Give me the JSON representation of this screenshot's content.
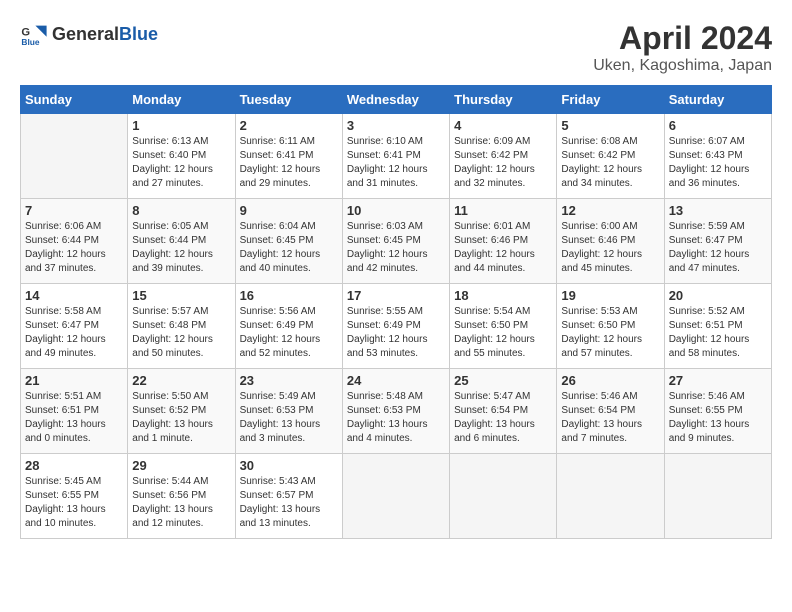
{
  "header": {
    "logo_general": "General",
    "logo_blue": "Blue",
    "title": "April 2024",
    "subtitle": "Uken, Kagoshima, Japan"
  },
  "days_of_week": [
    "Sunday",
    "Monday",
    "Tuesday",
    "Wednesday",
    "Thursday",
    "Friday",
    "Saturday"
  ],
  "weeks": [
    [
      {
        "day": "",
        "info": ""
      },
      {
        "day": "1",
        "info": "Sunrise: 6:13 AM\nSunset: 6:40 PM\nDaylight: 12 hours\nand 27 minutes."
      },
      {
        "day": "2",
        "info": "Sunrise: 6:11 AM\nSunset: 6:41 PM\nDaylight: 12 hours\nand 29 minutes."
      },
      {
        "day": "3",
        "info": "Sunrise: 6:10 AM\nSunset: 6:41 PM\nDaylight: 12 hours\nand 31 minutes."
      },
      {
        "day": "4",
        "info": "Sunrise: 6:09 AM\nSunset: 6:42 PM\nDaylight: 12 hours\nand 32 minutes."
      },
      {
        "day": "5",
        "info": "Sunrise: 6:08 AM\nSunset: 6:42 PM\nDaylight: 12 hours\nand 34 minutes."
      },
      {
        "day": "6",
        "info": "Sunrise: 6:07 AM\nSunset: 6:43 PM\nDaylight: 12 hours\nand 36 minutes."
      }
    ],
    [
      {
        "day": "7",
        "info": "Sunrise: 6:06 AM\nSunset: 6:44 PM\nDaylight: 12 hours\nand 37 minutes."
      },
      {
        "day": "8",
        "info": "Sunrise: 6:05 AM\nSunset: 6:44 PM\nDaylight: 12 hours\nand 39 minutes."
      },
      {
        "day": "9",
        "info": "Sunrise: 6:04 AM\nSunset: 6:45 PM\nDaylight: 12 hours\nand 40 minutes."
      },
      {
        "day": "10",
        "info": "Sunrise: 6:03 AM\nSunset: 6:45 PM\nDaylight: 12 hours\nand 42 minutes."
      },
      {
        "day": "11",
        "info": "Sunrise: 6:01 AM\nSunset: 6:46 PM\nDaylight: 12 hours\nand 44 minutes."
      },
      {
        "day": "12",
        "info": "Sunrise: 6:00 AM\nSunset: 6:46 PM\nDaylight: 12 hours\nand 45 minutes."
      },
      {
        "day": "13",
        "info": "Sunrise: 5:59 AM\nSunset: 6:47 PM\nDaylight: 12 hours\nand 47 minutes."
      }
    ],
    [
      {
        "day": "14",
        "info": "Sunrise: 5:58 AM\nSunset: 6:47 PM\nDaylight: 12 hours\nand 49 minutes."
      },
      {
        "day": "15",
        "info": "Sunrise: 5:57 AM\nSunset: 6:48 PM\nDaylight: 12 hours\nand 50 minutes."
      },
      {
        "day": "16",
        "info": "Sunrise: 5:56 AM\nSunset: 6:49 PM\nDaylight: 12 hours\nand 52 minutes."
      },
      {
        "day": "17",
        "info": "Sunrise: 5:55 AM\nSunset: 6:49 PM\nDaylight: 12 hours\nand 53 minutes."
      },
      {
        "day": "18",
        "info": "Sunrise: 5:54 AM\nSunset: 6:50 PM\nDaylight: 12 hours\nand 55 minutes."
      },
      {
        "day": "19",
        "info": "Sunrise: 5:53 AM\nSunset: 6:50 PM\nDaylight: 12 hours\nand 57 minutes."
      },
      {
        "day": "20",
        "info": "Sunrise: 5:52 AM\nSunset: 6:51 PM\nDaylight: 12 hours\nand 58 minutes."
      }
    ],
    [
      {
        "day": "21",
        "info": "Sunrise: 5:51 AM\nSunset: 6:51 PM\nDaylight: 13 hours\nand 0 minutes."
      },
      {
        "day": "22",
        "info": "Sunrise: 5:50 AM\nSunset: 6:52 PM\nDaylight: 13 hours\nand 1 minute."
      },
      {
        "day": "23",
        "info": "Sunrise: 5:49 AM\nSunset: 6:53 PM\nDaylight: 13 hours\nand 3 minutes."
      },
      {
        "day": "24",
        "info": "Sunrise: 5:48 AM\nSunset: 6:53 PM\nDaylight: 13 hours\nand 4 minutes."
      },
      {
        "day": "25",
        "info": "Sunrise: 5:47 AM\nSunset: 6:54 PM\nDaylight: 13 hours\nand 6 minutes."
      },
      {
        "day": "26",
        "info": "Sunrise: 5:46 AM\nSunset: 6:54 PM\nDaylight: 13 hours\nand 7 minutes."
      },
      {
        "day": "27",
        "info": "Sunrise: 5:46 AM\nSunset: 6:55 PM\nDaylight: 13 hours\nand 9 minutes."
      }
    ],
    [
      {
        "day": "28",
        "info": "Sunrise: 5:45 AM\nSunset: 6:55 PM\nDaylight: 13 hours\nand 10 minutes."
      },
      {
        "day": "29",
        "info": "Sunrise: 5:44 AM\nSunset: 6:56 PM\nDaylight: 13 hours\nand 12 minutes."
      },
      {
        "day": "30",
        "info": "Sunrise: 5:43 AM\nSunset: 6:57 PM\nDaylight: 13 hours\nand 13 minutes."
      },
      {
        "day": "",
        "info": ""
      },
      {
        "day": "",
        "info": ""
      },
      {
        "day": "",
        "info": ""
      },
      {
        "day": "",
        "info": ""
      }
    ]
  ]
}
